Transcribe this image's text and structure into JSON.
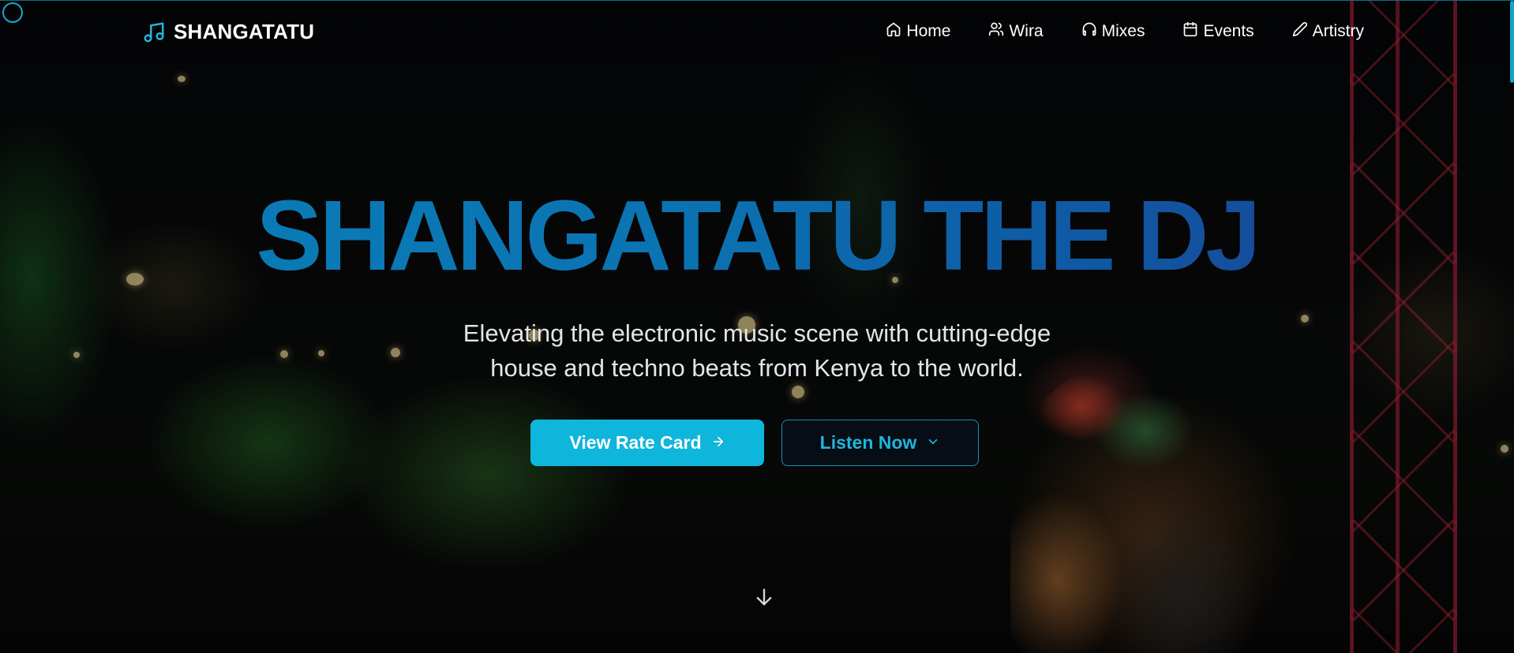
{
  "brand": {
    "name": "SHANGATATU",
    "icon": "music-note-icon"
  },
  "nav": {
    "items": [
      {
        "label": "Home",
        "icon": "home-icon"
      },
      {
        "label": "Wira",
        "icon": "users-icon"
      },
      {
        "label": "Mixes",
        "icon": "headphones-icon"
      },
      {
        "label": "Events",
        "icon": "calendar-icon"
      },
      {
        "label": "Artistry",
        "icon": "pencil-icon"
      }
    ]
  },
  "hero": {
    "title": "SHANGATATU THE DJ",
    "subtitle_line1": "Elevating the electronic music scene with cutting-edge",
    "subtitle_line2": "house and techno beats from Kenya to the world.",
    "primary_cta": {
      "label": "View Rate Card",
      "icon": "arrow-right-icon"
    },
    "secondary_cta": {
      "label": "Listen Now",
      "icon": "chevron-down-icon"
    },
    "scroll_icon": "arrow-down-icon"
  },
  "colors": {
    "accent": "#0fb6dc",
    "title_gradient_start": "#0a7fb8",
    "title_gradient_end": "#1c3f92",
    "text": "#ffffff"
  }
}
